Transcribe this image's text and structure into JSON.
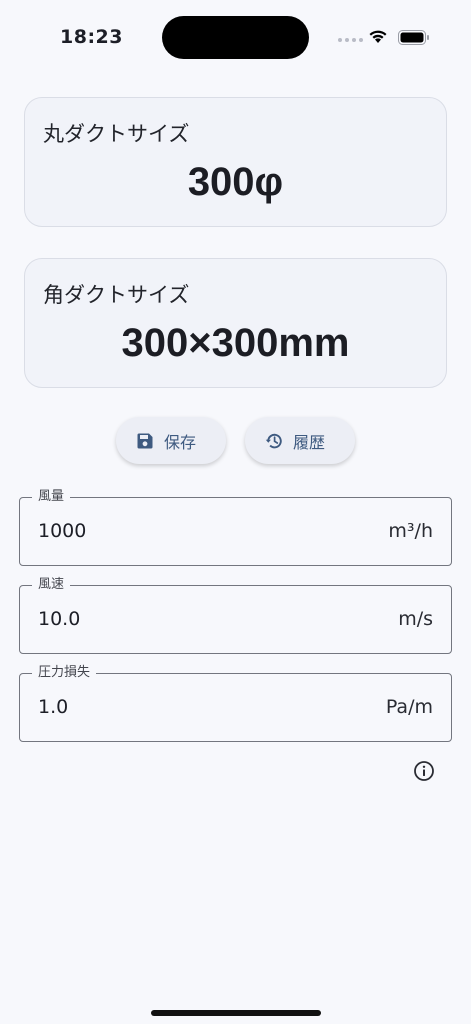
{
  "status_bar": {
    "time": "18:23",
    "icons": [
      "signal-dots-icon",
      "wifi-icon",
      "battery-icon"
    ]
  },
  "round_duct": {
    "label": "丸ダクトサイズ",
    "value": "300φ"
  },
  "square_duct": {
    "label": "角ダクトサイズ",
    "value": "300×300mm"
  },
  "actions": {
    "save_label": "保存",
    "save_icon": "floppy-disk-icon",
    "history_label": "履歴",
    "history_icon": "history-clock-icon"
  },
  "fields": {
    "airflow": {
      "label": "風量",
      "value": "1000",
      "unit": "m³/h"
    },
    "velocity": {
      "label": "風速",
      "value": "10.0",
      "unit": "m/s"
    },
    "pressure_loss": {
      "label": "圧力損失",
      "value": "1.0",
      "unit": "Pa/m"
    }
  },
  "info_icon": "info-circle-icon",
  "colors": {
    "background": "#f7f8fc",
    "card_background": "#f1f3f9",
    "accent": "#3e5a80",
    "text": "#1d1f27"
  }
}
